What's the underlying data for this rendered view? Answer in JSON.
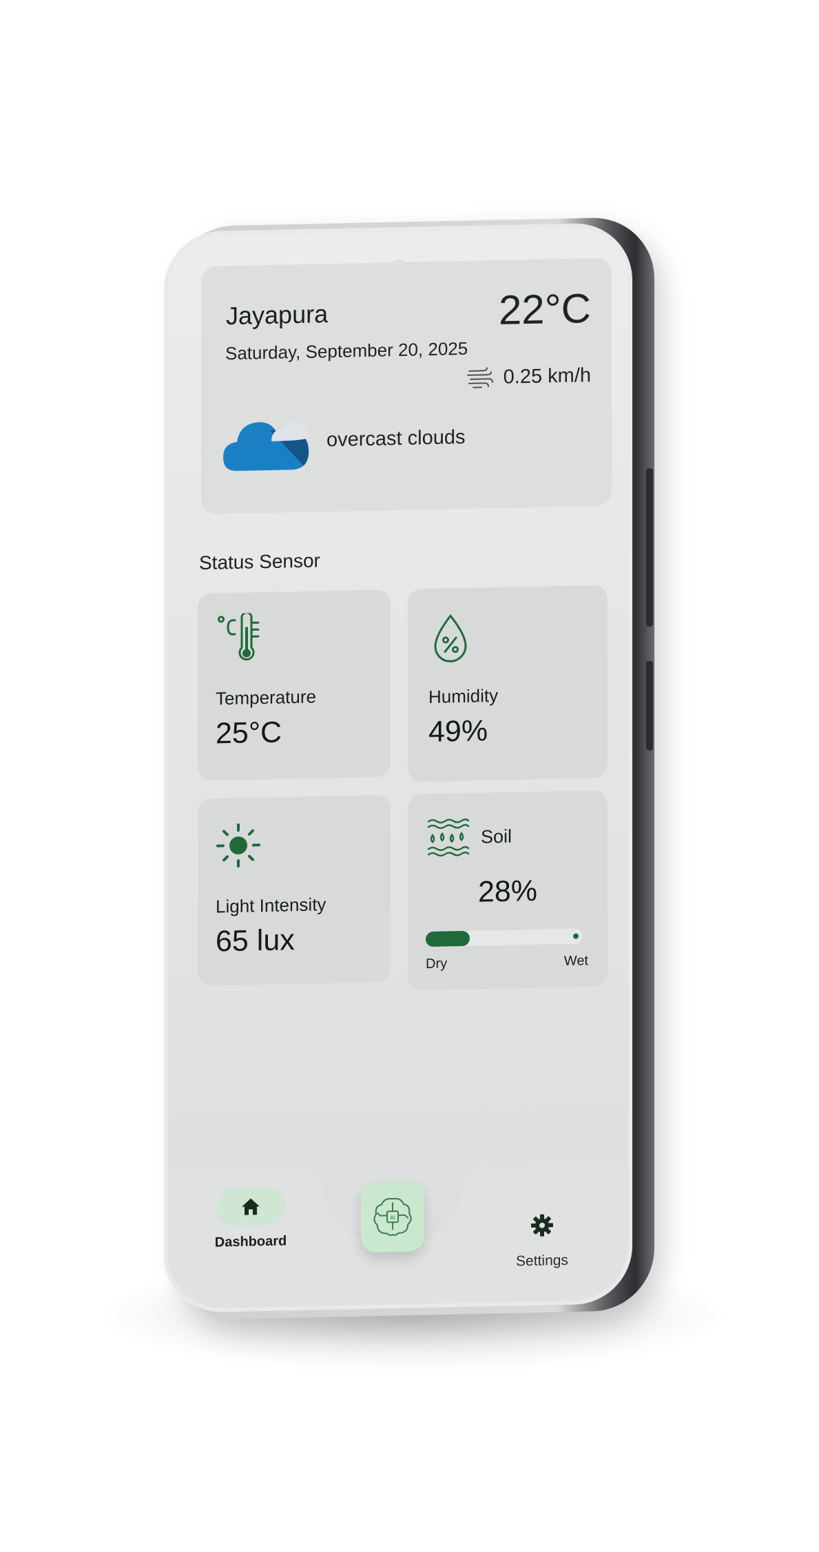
{
  "weather": {
    "city": "Jayapura",
    "date": "Saturday, September 20, 2025",
    "temperature": "22°C",
    "wind_speed": "0.25 km/h",
    "description": "overcast clouds",
    "cloud_icon": "cloud-partly-icon",
    "wind_icon": "wind-icon"
  },
  "section_title": "Status Sensor",
  "sensors": {
    "temperature": {
      "label": "Temperature",
      "value": "25°C",
      "icon": "thermometer-icon"
    },
    "humidity": {
      "label": "Humidity",
      "value": "49%",
      "icon": "humidity-drop-icon"
    },
    "light": {
      "label": "Light Intensity",
      "value": "65 lux",
      "icon": "sun-icon"
    },
    "soil": {
      "label": "Soil",
      "value": "28%",
      "level_percent": 28,
      "min_label": "Dry",
      "max_label": "Wet",
      "icon": "soil-moisture-icon"
    }
  },
  "nav": {
    "dashboard_label": "Dashboard",
    "settings_label": "Settings",
    "ai_button_icon": "ai-brain-icon",
    "dashboard_icon": "home-icon",
    "settings_icon": "gear-icon"
  },
  "colors": {
    "accent_green": "#1f6a3a",
    "pill_green": "#cfe6d4",
    "fab_green": "#c9e8cd",
    "cloud_blue": "#1b7fc4"
  }
}
